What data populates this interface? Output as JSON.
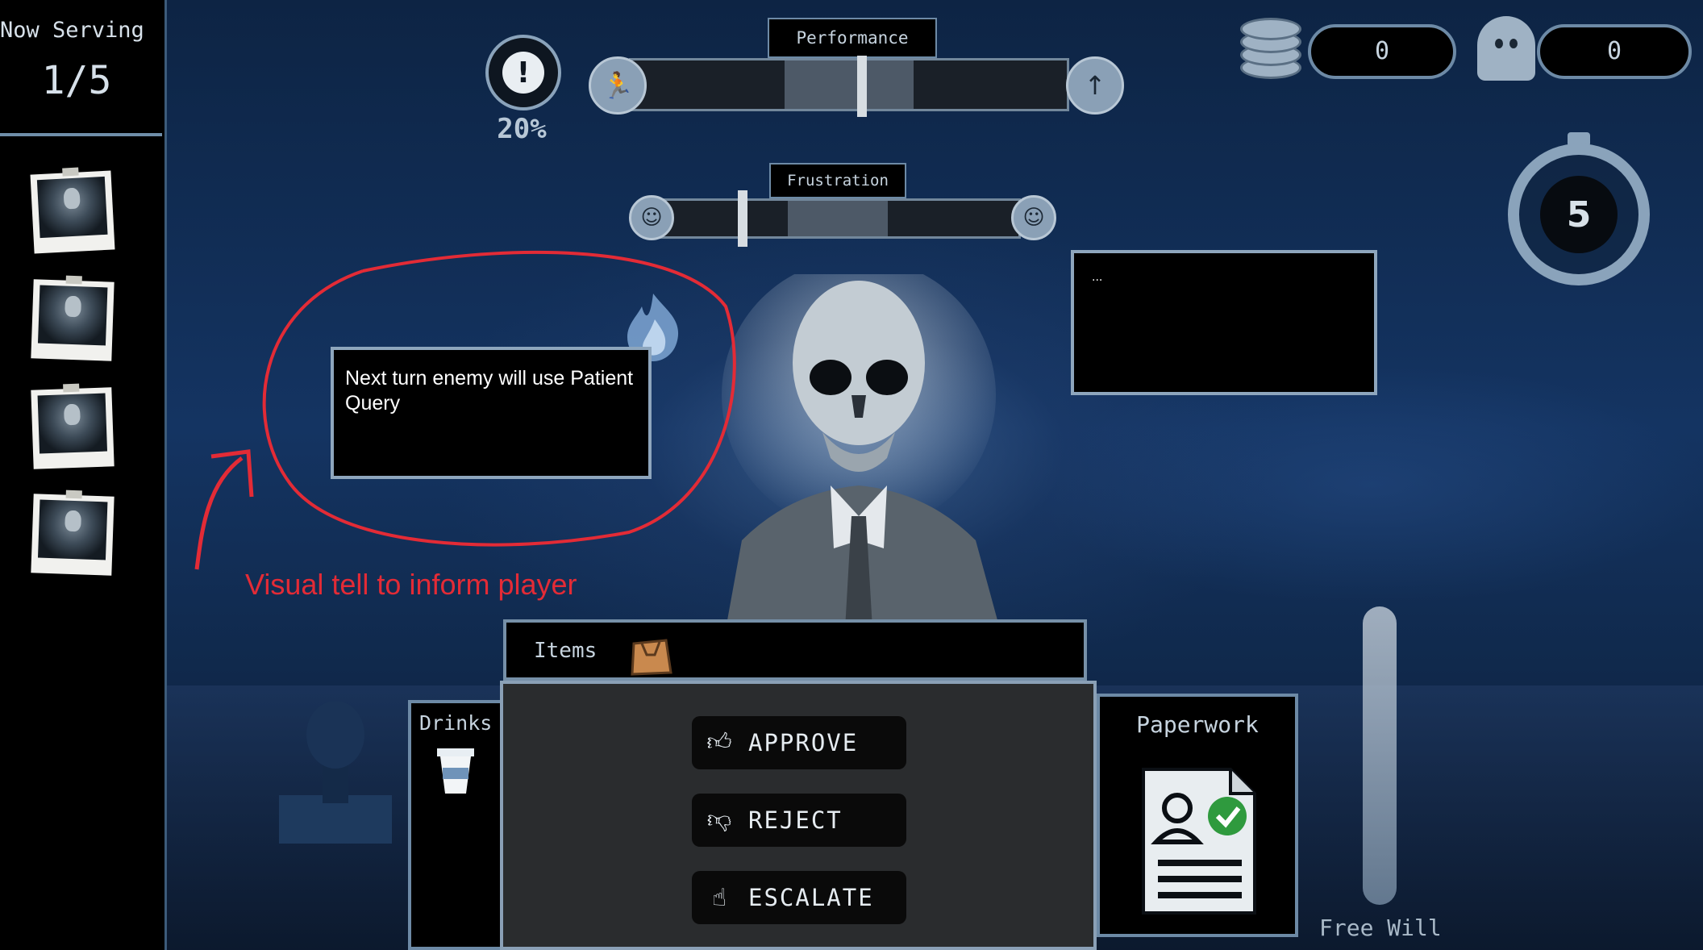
{
  "sidebar": {
    "now_serving_label": "Now Serving",
    "now_serving_count": "1/5",
    "queue_portraits": 4
  },
  "hud": {
    "alert_percent": "20%",
    "performance_label": "Performance",
    "performance_level": 0.53,
    "frustration_label": "Frustration",
    "frustration_level": 0.24,
    "coins": "0",
    "ghosts": "0",
    "turn_timer": "5"
  },
  "enemy_intent": {
    "text": "Next turn enemy will use Patient Query"
  },
  "speech": {
    "text": "..."
  },
  "annotation": {
    "text": "Visual tell to inform player",
    "color": "#e32b36"
  },
  "items": {
    "label": "Items"
  },
  "drinks": {
    "label": "Drinks"
  },
  "actions": {
    "approve": "APPROVE",
    "reject": "REJECT",
    "escalate": "ESCALATE"
  },
  "paperwork": {
    "label": "Paperwork"
  },
  "free_will": {
    "label": "Free Will"
  },
  "colors": {
    "panel_border": "#8ea6bd",
    "background": "#143462"
  }
}
